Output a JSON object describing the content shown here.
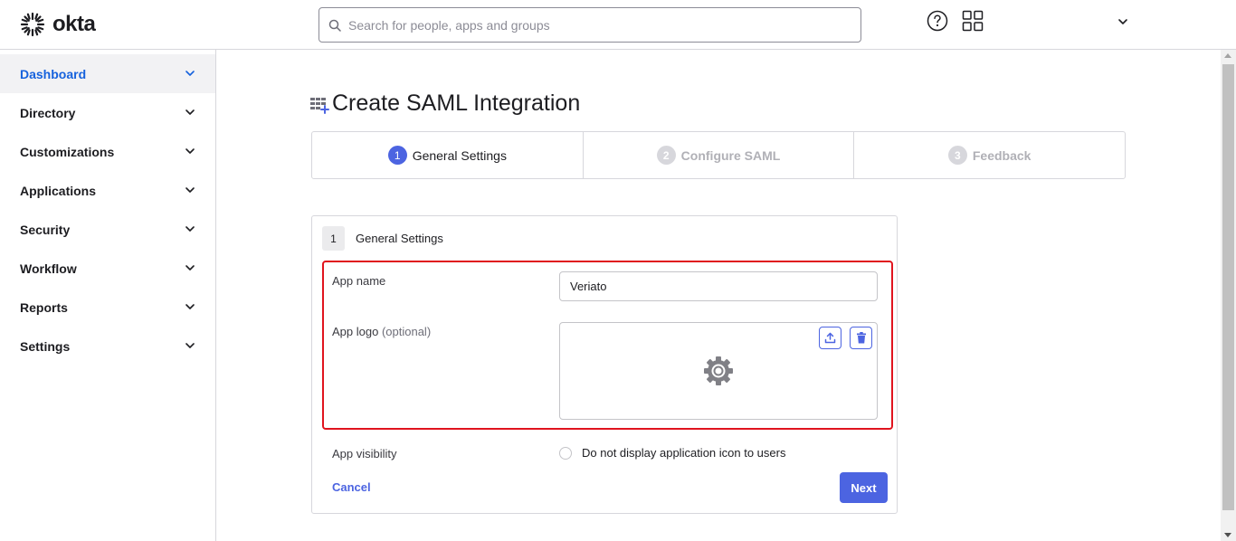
{
  "header": {
    "logo_text": "okta",
    "search_placeholder": "Search for people, apps and groups",
    "icons": [
      "help-icon",
      "apps-grid-icon",
      "chevron-down-icon"
    ]
  },
  "sidebar": {
    "items": [
      {
        "label": "Dashboard",
        "active": true
      },
      {
        "label": "Directory",
        "active": false
      },
      {
        "label": "Customizations",
        "active": false
      },
      {
        "label": "Applications",
        "active": false
      },
      {
        "label": "Security",
        "active": false
      },
      {
        "label": "Workflow",
        "active": false
      },
      {
        "label": "Reports",
        "active": false
      },
      {
        "label": "Settings",
        "active": false
      }
    ]
  },
  "main": {
    "title": "Create SAML Integration",
    "steps": [
      {
        "num": "1",
        "label": "General Settings",
        "state": "current"
      },
      {
        "num": "2",
        "label": "Configure SAML",
        "state": "future"
      },
      {
        "num": "3",
        "label": "Feedback",
        "state": "future"
      }
    ],
    "card": {
      "badge": "1",
      "heading": "General Settings",
      "app_name_label": "App name",
      "app_name_value": "Veriato",
      "app_logo_label": "App logo",
      "app_logo_optional": "(optional)",
      "app_visibility_label": "App visibility",
      "visibility_option": "Do not display application icon to users",
      "visibility_checked": false,
      "cancel_label": "Cancel",
      "next_label": "Next"
    }
  },
  "colors": {
    "accent": "#4c64e1",
    "active_nav": "#1662dd",
    "highlight": "#e0141e"
  }
}
